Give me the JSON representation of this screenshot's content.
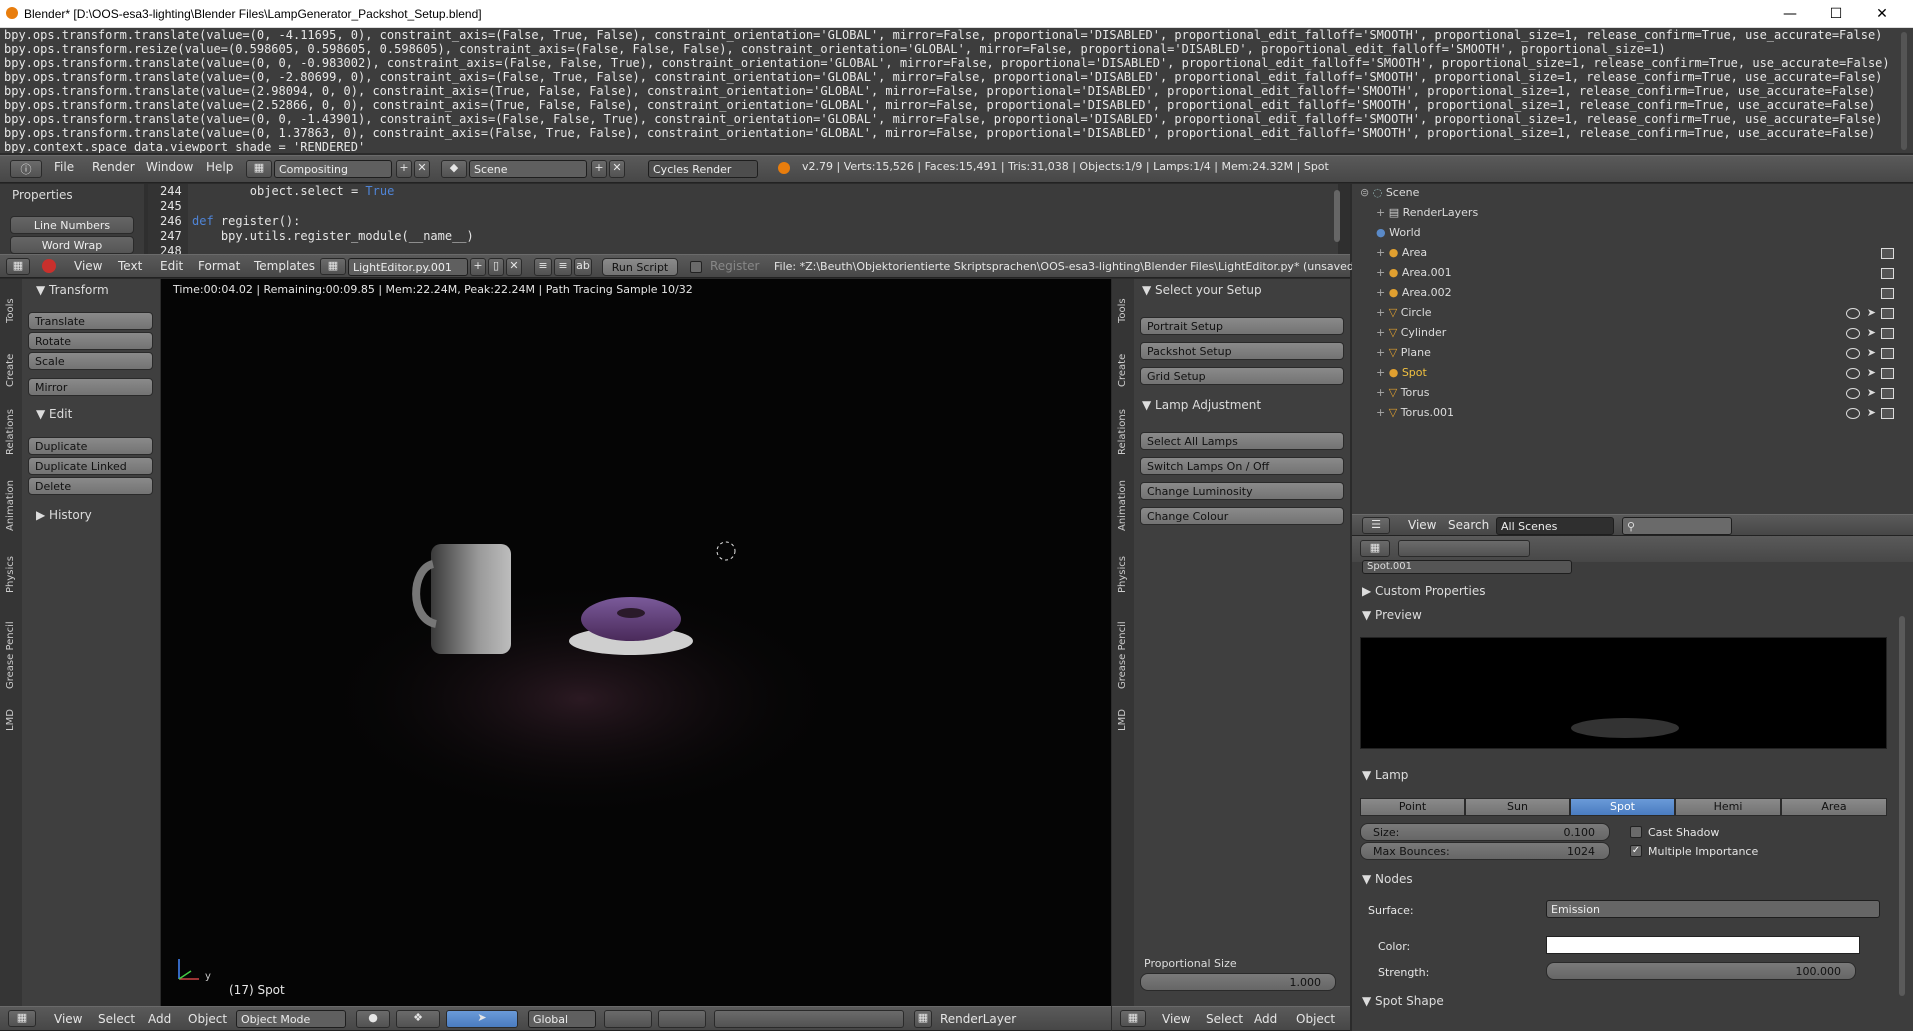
{
  "window": {
    "title": "Blender* [D:\\OOS-esa3-lighting\\Blender Files\\LampGenerator_Packshot_Setup.blend]",
    "minimize": "—",
    "maximize": "☐",
    "close": "✕"
  },
  "info_log": {
    "lines": "bpy.ops.transform.translate(value=(0, -4.11695, 0), constraint_axis=(False, True, False), constraint_orientation='GLOBAL', mirror=False, proportional='DISABLED', proportional_edit_falloff='SMOOTH', proportional_size=1, release_confirm=True, use_accurate=False)\nbpy.ops.transform.resize(value=(0.598605, 0.598605, 0.598605), constraint_axis=(False, False, False), constraint_orientation='GLOBAL', mirror=False, proportional='DISABLED', proportional_edit_falloff='SMOOTH', proportional_size=1)\nbpy.ops.transform.translate(value=(0, 0, -0.983002), constraint_axis=(False, False, True), constraint_orientation='GLOBAL', mirror=False, proportional='DISABLED', proportional_edit_falloff='SMOOTH', proportional_size=1, release_confirm=True, use_accurate=False)\nbpy.ops.transform.translate(value=(0, -2.80699, 0), constraint_axis=(False, True, False), constraint_orientation='GLOBAL', mirror=False, proportional='DISABLED', proportional_edit_falloff='SMOOTH', proportional_size=1, release_confirm=True, use_accurate=False)\nbpy.ops.transform.translate(value=(2.98094, 0, 0), constraint_axis=(True, False, False), constraint_orientation='GLOBAL', mirror=False, proportional='DISABLED', proportional_edit_falloff='SMOOTH', proportional_size=1, release_confirm=True, use_accurate=False)\nbpy.ops.transform.translate(value=(2.52866, 0, 0), constraint_axis=(True, False, False), constraint_orientation='GLOBAL', mirror=False, proportional='DISABLED', proportional_edit_falloff='SMOOTH', proportional_size=1, release_confirm=True, use_accurate=False)\nbpy.ops.transform.translate(value=(0, 0, -1.43901), constraint_axis=(False, False, True), constraint_orientation='GLOBAL', mirror=False, proportional='DISABLED', proportional_edit_falloff='SMOOTH', proportional_size=1, release_confirm=True, use_accurate=False)\nbpy.ops.transform.translate(value=(0, 1.37863, 0), constraint_axis=(False, True, False), constraint_orientation='GLOBAL', mirror=False, proportional='DISABLED', proportional_edit_falloff='SMOOTH', proportional_size=1, release_confirm=True, use_accurate=False)\nbpy.context.space_data.viewport_shade = 'RENDERED'"
  },
  "top_header": {
    "menus": [
      "File",
      "Render",
      "Window",
      "Help"
    ],
    "screen_layout": "Compositing",
    "scene": "Scene",
    "engine": "Cycles Render",
    "stats": "v2.79 | Verts:15,526 | Faces:15,491 | Tris:31,038 | Objects:1/9 | Lamps:1/4 | Mem:24.32M | Spot"
  },
  "text_editor": {
    "properties_title": "Properties",
    "line_numbers_btn": "Line Numbers",
    "word_wrap_btn": "Word Wrap",
    "line_nums": [
      "244",
      "245",
      "246",
      "247",
      "248"
    ],
    "code_244": "        object.select = ",
    "code_244_kw": "True",
    "code_246_kw": "def",
    "code_246": " register():",
    "code_247": "    bpy.utils.register_module(__name__)",
    "menus": [
      "View",
      "Text",
      "Edit",
      "Format",
      "Templates"
    ],
    "file_name": "LightEditor.py.001",
    "run_script": "Run Script",
    "register": "Register",
    "file_path": "File: *Z:\\Beuth\\Objektorientierte Skriptsprachen\\OOS-esa3-lighting\\Blender Files\\LightEditor.py* (unsaved)"
  },
  "tool_shelf": {
    "tabs": [
      "Tools",
      "Create",
      "Relations",
      "Animation",
      "Physics",
      "Grease Pencil",
      "LMD"
    ],
    "transform_title": "Transform",
    "translate": "Translate",
    "rotate": "Rotate",
    "scale": "Scale",
    "mirror": "Mirror",
    "edit_title": "Edit",
    "duplicate": "Duplicate",
    "duplicate_linked": "Duplicate Linked",
    "delete": "Delete",
    "history_title": "History"
  },
  "viewport": {
    "render_status": "Time:00:04.02 | Remaining:00:09.85 | Mem:22.24M, Peak:22.24M | Path Tracing Sample 10/32",
    "object_label": "(17) Spot",
    "axis_y": "y",
    "footer_menus": [
      "View",
      "Select",
      "Add",
      "Object"
    ],
    "mode": "Object Mode",
    "orientation": "Global",
    "render_layer": "RenderLayer"
  },
  "lamp_panel": {
    "setup_title": "Select your Setup",
    "portrait": "Portrait Setup",
    "packshot": "Packshot Setup",
    "grid": "Grid Setup",
    "adjust_title": "Lamp Adjustment",
    "select_all": "Select All Lamps",
    "switch": "Switch Lamps On / Off",
    "luminosity": "Change Luminosity",
    "colour": "Change Colour",
    "prop_size_label": "Proportional Size",
    "prop_size_value": "1.000",
    "footer_menus": [
      "View",
      "Select",
      "Add",
      "Object"
    ]
  },
  "outliner": {
    "items": [
      {
        "name": "Scene",
        "level": 0
      },
      {
        "name": "RenderLayers",
        "level": 1
      },
      {
        "name": "World",
        "level": 1
      },
      {
        "name": "Area",
        "level": 1
      },
      {
        "name": "Area.001",
        "level": 1
      },
      {
        "name": "Area.002",
        "level": 1
      },
      {
        "name": "Circle",
        "level": 1
      },
      {
        "name": "Cylinder",
        "level": 1
      },
      {
        "name": "Plane",
        "level": 1
      },
      {
        "name": "Spot",
        "level": 1
      },
      {
        "name": "Torus",
        "level": 1
      },
      {
        "name": "Torus.001",
        "level": 1
      }
    ],
    "view": "View",
    "search": "Search",
    "scenes_dropdown": "All Scenes"
  },
  "properties": {
    "datablock": "Spot.001",
    "custom_props": "Custom Properties",
    "preview": "Preview",
    "lamp": "Lamp",
    "lamp_types": [
      "Point",
      "Sun",
      "Spot",
      "Hemi",
      "Area"
    ],
    "active_type": "Spot",
    "size_label": "Size:",
    "size_value": "0.100",
    "bounces_label": "Max Bounces:",
    "bounces_value": "1024",
    "cast_shadow": "Cast Shadow",
    "multiple_importance": "Multiple Importance",
    "nodes": "Nodes",
    "surface_label": "Surface:",
    "surface_value": "Emission",
    "color_label": "Color:",
    "strength_label": "Strength:",
    "strength_value": "100.000",
    "spot_shape": "Spot Shape"
  }
}
